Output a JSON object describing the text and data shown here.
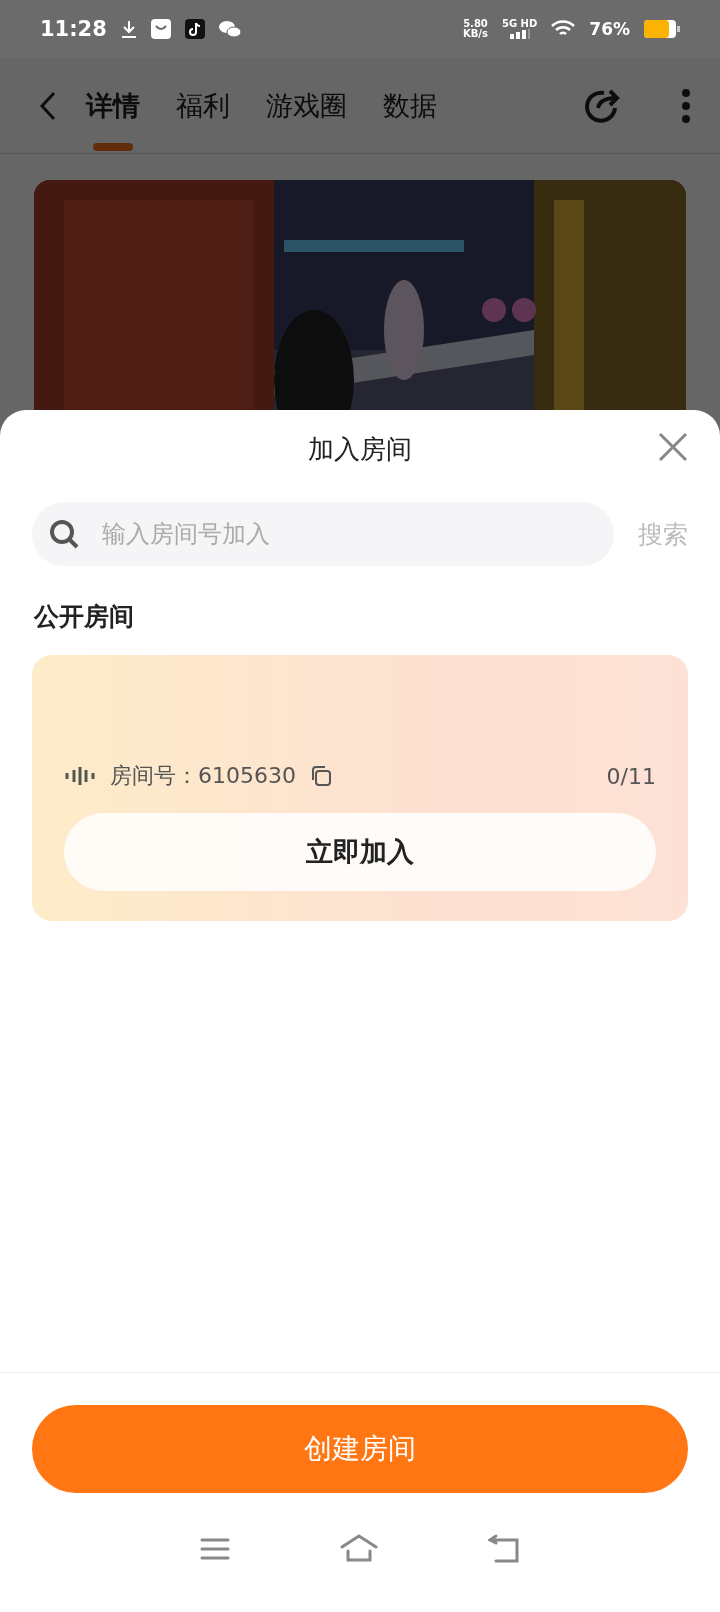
{
  "status_bar": {
    "time": "11:28",
    "net_speed": "5.80",
    "net_speed_unit": "KB/s",
    "network": "5G HD",
    "battery": "76%"
  },
  "nav": {
    "tabs": [
      {
        "label": "详情",
        "selected": true
      },
      {
        "label": "福利",
        "selected": false
      },
      {
        "label": "游戏圈",
        "selected": false
      },
      {
        "label": "数据",
        "selected": false
      }
    ]
  },
  "sheet": {
    "title": "加入房间",
    "search": {
      "placeholder": "输入房间号加入",
      "button": "搜索"
    },
    "section_title": "公开房间",
    "rooms": [
      {
        "room": "房间号：6105630",
        "occupancy": "0/11",
        "join": "立即加入"
      }
    ],
    "create_button": "创建房间"
  }
}
